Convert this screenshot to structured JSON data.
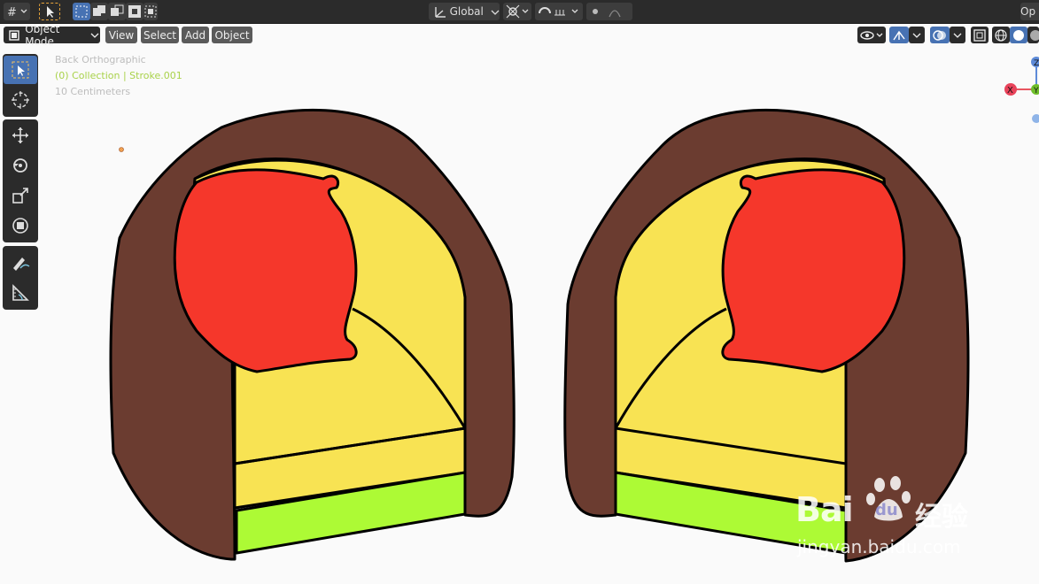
{
  "topbar": {
    "transform_orientation": "Global",
    "options_label": "Op"
  },
  "header": {
    "mode": "Object Mode",
    "menus": [
      "View",
      "Select",
      "Add",
      "Object"
    ]
  },
  "viewport": {
    "view_name": "Back Orthographic",
    "collection": "(0) Collection | Stroke.001",
    "scale": "10 Centimeters"
  },
  "gizmo": {
    "x_label": "X",
    "y_label": "Y",
    "z_label": "Z"
  },
  "colors": {
    "brown": "#6b3c30",
    "yellow": "#f8e353",
    "red": "#f5372b",
    "green": "#adfa35",
    "outline": "#000000",
    "accent": "#4772b3"
  },
  "watermark": {
    "brand": "Bai",
    "brand2": "du",
    "cn": "经验",
    "url": "jingyan.baidu.com"
  }
}
